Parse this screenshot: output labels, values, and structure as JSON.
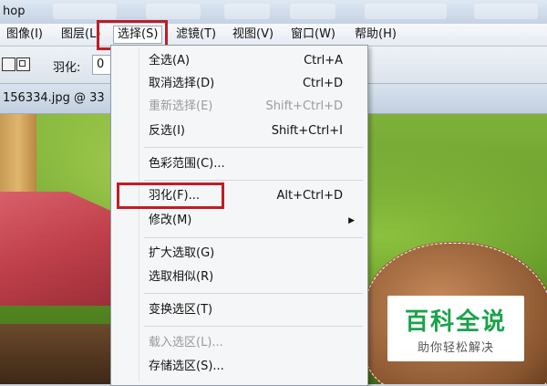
{
  "app": {
    "title_fragment": "hop"
  },
  "menubar": {
    "items": [
      {
        "label": "图像(I)"
      },
      {
        "label": "图层(L)"
      },
      {
        "label": "选择(S)"
      },
      {
        "label": "滤镜(T)"
      },
      {
        "label": "视图(V)"
      },
      {
        "label": "窗口(W)"
      },
      {
        "label": "帮助(H)"
      }
    ]
  },
  "options_bar": {
    "feather_label": "羽化:",
    "feather_value": "0"
  },
  "document": {
    "name": "156334.jpg @ 33"
  },
  "select_menu": {
    "items": [
      {
        "label": "全选(A)",
        "shortcut": "Ctrl+A",
        "disabled": false
      },
      {
        "label": "取消选择(D)",
        "shortcut": "Ctrl+D",
        "disabled": false
      },
      {
        "label": "重新选择(E)",
        "shortcut": "Shift+Ctrl+D",
        "disabled": true
      },
      {
        "label": "反选(I)",
        "shortcut": "Shift+Ctrl+I",
        "disabled": false
      },
      {
        "label": "色彩范围(C)...",
        "shortcut": "",
        "disabled": false
      },
      {
        "label": "羽化(F)...",
        "shortcut": "Alt+Ctrl+D",
        "disabled": false
      },
      {
        "label": "修改(M)",
        "shortcut": "",
        "disabled": false
      },
      {
        "label": "扩大选取(G)",
        "shortcut": "",
        "disabled": false
      },
      {
        "label": "选取相似(R)",
        "shortcut": "",
        "disabled": false
      },
      {
        "label": "变换选区(T)",
        "shortcut": "",
        "disabled": false
      },
      {
        "label": "载入选区(L)...",
        "shortcut": "",
        "disabled": true
      },
      {
        "label": "存储选区(S)...",
        "shortcut": "",
        "disabled": false
      }
    ]
  },
  "watermark": {
    "title": "百科全说",
    "subtitle": "助你轻松解决"
  },
  "colors": {
    "highlight": "#c01d24",
    "watermark_green": "#1aa34a"
  }
}
